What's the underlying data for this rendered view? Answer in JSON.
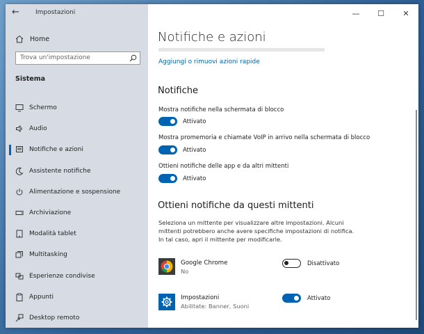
{
  "window": {
    "app_title": "Impostazioni",
    "controls": {
      "minimize": "—",
      "maximize": "☐",
      "close": "✕"
    }
  },
  "sidebar": {
    "home_label": "Home",
    "search_placeholder": "Trova un'impostazione",
    "section": "Sistema",
    "items": [
      {
        "label": "Schermo",
        "icon": "monitor-icon"
      },
      {
        "label": "Audio",
        "icon": "speaker-icon"
      },
      {
        "label": "Notifiche e azioni",
        "icon": "notification-icon",
        "active": true
      },
      {
        "label": "Assistente notifiche",
        "icon": "moon-icon"
      },
      {
        "label": "Alimentazione e sospensione",
        "icon": "power-icon"
      },
      {
        "label": "Archiviazione",
        "icon": "storage-icon"
      },
      {
        "label": "Modalità tablet",
        "icon": "tablet-icon"
      },
      {
        "label": "Multitasking",
        "icon": "multitasking-icon"
      },
      {
        "label": "Esperienze condivise",
        "icon": "shared-icon"
      },
      {
        "label": "Appunti",
        "icon": "clipboard-icon"
      },
      {
        "label": "Desktop remoto",
        "icon": "remote-desktop-icon"
      }
    ]
  },
  "main": {
    "title": "Notifiche e azioni",
    "quick_actions_link": "Aggiungi o rimuovi azioni rapide",
    "notifications_heading": "Notifiche",
    "settings": [
      {
        "label": "Mostra notifiche nella schermata di blocco",
        "state": "Attivato",
        "on": true
      },
      {
        "label": "Mostra promemoria e chiamate VoIP in arrivo nella schermata di blocco",
        "state": "Attivato",
        "on": true
      },
      {
        "label": "Ottieni notifiche delle app e da altri mittenti",
        "state": "Attivato",
        "on": true
      }
    ],
    "senders_heading": "Ottieni notifiche da questi mittenti",
    "senders_description": "Seleziona un mittente per visualizzare altre impostazioni. Alcuni mittenti potrebbero anche avere specifiche impostazioni di notifica. In tal caso, apri il mittente per modificarle.",
    "senders": [
      {
        "name": "Google Chrome",
        "sub": "No",
        "state": "Disattivato",
        "on": false,
        "icon": "chrome-icon"
      },
      {
        "name": "Impostazioni",
        "sub": "Abilitate: Banner, Suoni",
        "state": "Attivato",
        "on": true,
        "icon": "gear-icon"
      }
    ]
  },
  "colors": {
    "accent": "#0063b1",
    "sidebar_bg": "#d7dce4"
  }
}
